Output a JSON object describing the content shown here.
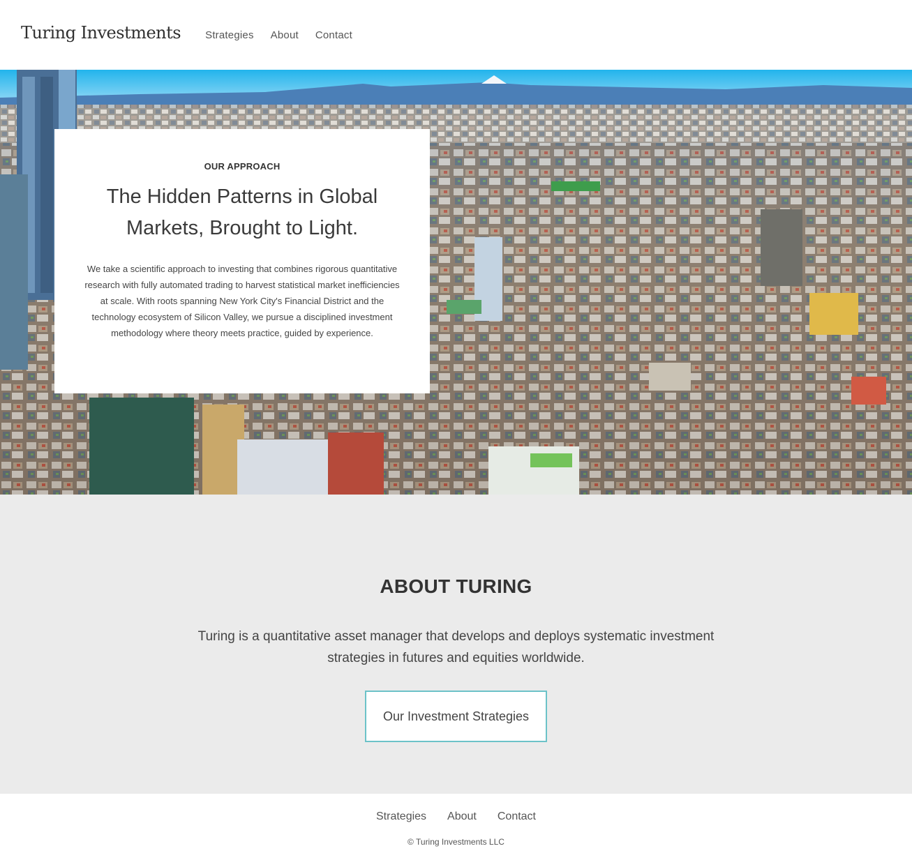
{
  "header": {
    "logo": "Turing Investments",
    "nav": [
      "Strategies",
      "About",
      "Contact"
    ]
  },
  "hero": {
    "image": "city-skyline-photo",
    "eyebrow": "OUR APPROACH",
    "title": "The Hidden Patterns in Global Markets, Brought to Light.",
    "body": "We take a scientific approach to investing that combines rigorous quantitative research with fully automated trading to harvest statistical market inefficiencies at scale. With roots spanning New York City's Financial District and the technology ecosystem of Silicon Valley, we pursue a disciplined investment methodology where theory meets practice, guided by experience."
  },
  "about": {
    "heading": "ABOUT TURING",
    "text": "Turing is a quantitative asset manager that develops and deploys systematic investment strategies in futures and equities worldwide.",
    "cta": "Our Investment Strategies"
  },
  "footer": {
    "nav": [
      "Strategies",
      "About",
      "Contact"
    ],
    "copyright": "© Turing Investments LLC"
  },
  "colors": {
    "accent": "#6cc2c8",
    "about_bg": "#ebebeb",
    "text": "#333333"
  }
}
